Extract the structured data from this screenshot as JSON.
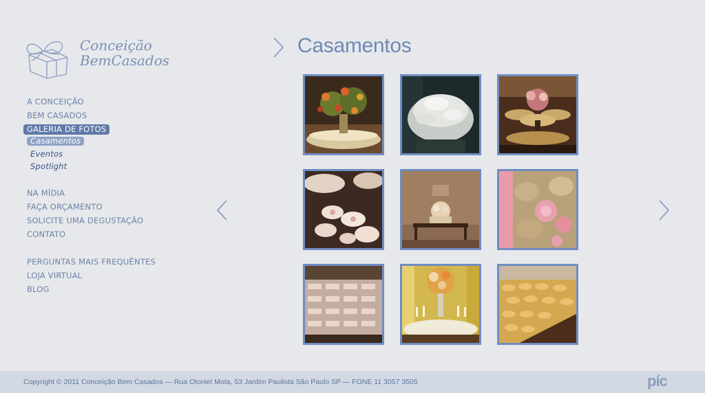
{
  "logo": {
    "line1": "Conceição",
    "line2": "BemCasados"
  },
  "menu": {
    "items1": [
      {
        "label": "A CONCEIÇÃO"
      },
      {
        "label": "BEM CASADOS"
      }
    ],
    "active_item": "GALERIA DE FOTOS",
    "sub_items": [
      {
        "label": "Casamentos"
      },
      {
        "label": "Eventos"
      },
      {
        "label": "Spotlight"
      }
    ],
    "items2": [
      {
        "label": "NA MÍDIA"
      },
      {
        "label": "FAÇA ORÇAMENTO"
      },
      {
        "label": "SOLICITE UMA DEGUSTAÇÃO"
      },
      {
        "label": "CONTATO"
      }
    ],
    "items3": [
      {
        "label": "PERGUNTAS MAIS FREQUÊNTES"
      },
      {
        "label": "LOJA VIRTUAL"
      },
      {
        "label": "BLOG"
      }
    ]
  },
  "main": {
    "title": "Casamentos"
  },
  "footer": {
    "copyright": "Copyright © 2011 Conceição Bem Casados  — Rua Otoniel Mota, 53 Jardim Paulista São Paulo SP — FONE 11 3057 3505",
    "brand": "píc"
  },
  "colors": {
    "accent": "#6f8dc2",
    "text": "#6d83a9",
    "background": "#e6e8eb"
  }
}
